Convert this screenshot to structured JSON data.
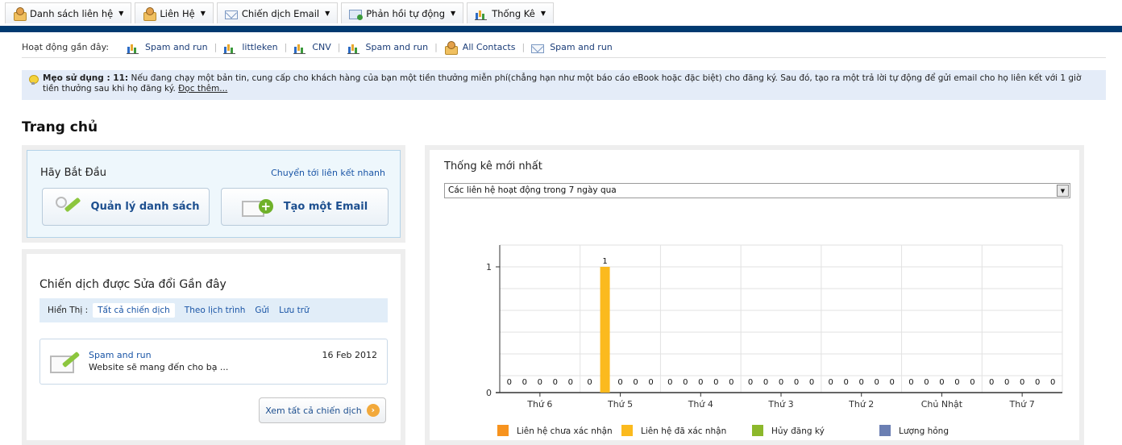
{
  "topnav": {
    "tabs": [
      {
        "label": "Danh sách liên hệ",
        "icon": "contacts-icon"
      },
      {
        "label": "Liên Hệ",
        "icon": "people-icon"
      },
      {
        "label": "Chiến dịch Email",
        "icon": "envelope-icon"
      },
      {
        "label": "Phản hồi tự động",
        "icon": "autoresponder-icon"
      },
      {
        "label": "Thống Kê",
        "icon": "chart-icon"
      }
    ]
  },
  "recent": {
    "label": "Hoạt động gần đây:",
    "items": [
      {
        "label": "Spam and run",
        "icon": "chart-icon"
      },
      {
        "label": "littleken",
        "icon": "chart-icon"
      },
      {
        "label": "CNV",
        "icon": "chart-icon"
      },
      {
        "label": "Spam and run",
        "icon": "chart-icon"
      },
      {
        "label": "All Contacts",
        "icon": "contacts-icon"
      },
      {
        "label": "Spam and run",
        "icon": "envelope-icon"
      }
    ]
  },
  "tip": {
    "prefix": "Mẹo sử dụng : 11:",
    "text": " Nếu đang chạy một bản tin, cung cấp cho khách hàng của bạn một tiền thưởng miễn phí(chẳng hạn như một báo cáo eBook hoặc đặc biệt) cho đăng ký. Sau đó, tạo ra một trả lời tự động để gửi email cho họ liên kết với 1 giờ tiền thưởng sau khi họ đăng ký. ",
    "link": "Đọc thêm..."
  },
  "page": {
    "title": "Trang chủ"
  },
  "start": {
    "title": "Hãy Bắt Đầu",
    "quicklink": "Chuyển tới liên kết nhanh",
    "manage_label": "Quản lý danh sách",
    "create_label": "Tạo một Email"
  },
  "campaigns": {
    "title": "Chiến dịch được Sửa đổi Gần đây",
    "filter_label": "Hiển Thị :",
    "filters": [
      "Tất cả chiến dịch",
      "Theo lịch trình",
      "Gửi",
      "Lưu trữ"
    ],
    "items": [
      {
        "name": "Spam and run",
        "desc": "Website sẽ mang đến cho bạ ...",
        "date": "16 Feb 2012"
      }
    ],
    "view_all": "Xem tất cả chiến dịch"
  },
  "stats": {
    "title": "Thống kê mới nhất",
    "select_value": "Các liên hệ hoạt động trong 7 ngày qua"
  },
  "chart_data": {
    "type": "bar",
    "categories": [
      "Thứ 6",
      "Thứ 5",
      "Thứ 4",
      "Thứ 3",
      "Thứ 2",
      "Chủ Nhật",
      "Thứ 7"
    ],
    "series": [
      {
        "name": "Liên hệ chưa xác nhận",
        "color": "#f7931e",
        "values": [
          0,
          0,
          0,
          0,
          0,
          0,
          0
        ]
      },
      {
        "name": "Liên hệ đã xác nhận",
        "color": "#fbba1e",
        "values": [
          0,
          1,
          0,
          0,
          0,
          0,
          0
        ]
      },
      {
        "name": "Hủy đăng ký",
        "color": "#8cb82b",
        "values": [
          0,
          0,
          0,
          0,
          0,
          0,
          0
        ]
      },
      {
        "name": "Lượng hỏng",
        "color": "#6b7fb3",
        "values": [
          0,
          0,
          0,
          0,
          0,
          0,
          0
        ]
      },
      {
        "name": "",
        "color": "#e8572a",
        "values": [
          0,
          0,
          0,
          0,
          0,
          0,
          0
        ]
      }
    ],
    "ylim": [
      0,
      1
    ],
    "yticks": [
      0,
      1
    ],
    "grid": true,
    "legend": "bottom"
  }
}
